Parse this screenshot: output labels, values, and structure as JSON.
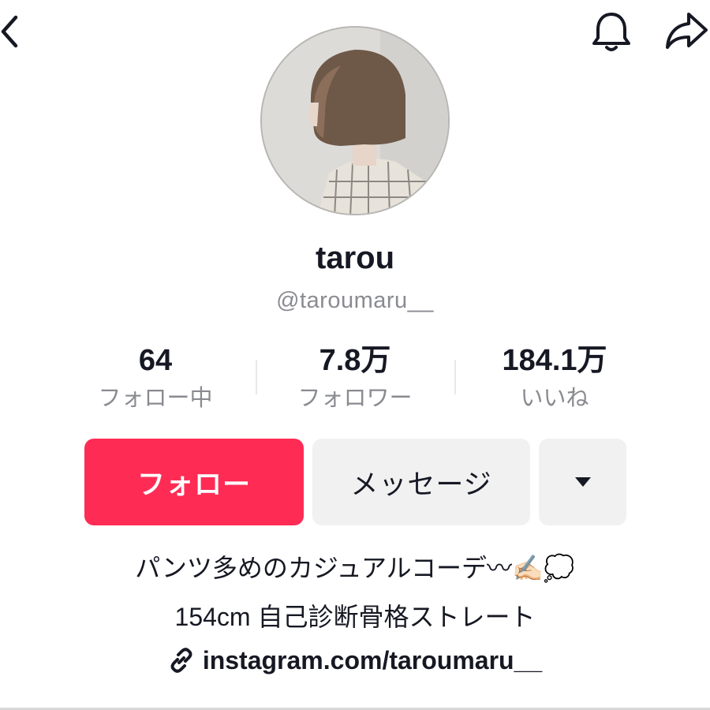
{
  "header": {
    "back_icon": "chevron-left-icon",
    "bell_icon": "bell-icon",
    "share_icon": "share-arrow-icon"
  },
  "profile": {
    "username": "tarou",
    "handle": "@taroumaru__",
    "avatar": "profile-photo"
  },
  "stats": [
    {
      "value": "64",
      "label": "フォロー中"
    },
    {
      "value": "7.8万",
      "label": "フォロワー"
    },
    {
      "value": "184.1万",
      "label": "いいね"
    }
  ],
  "actions": {
    "follow_label": "フォロー",
    "message_label": "メッセージ",
    "more_icon": "caret-down-icon"
  },
  "bio": {
    "line1": "パンツ多めのカジュアルコーデ〰✍🏻💭",
    "line2": "154cm 自己診断骨格ストレート",
    "link": "instagram.com/taroumaru__",
    "link_icon": "link-icon"
  },
  "colors": {
    "follow": "#fe2c55",
    "secondary_bg": "#f1f1f2",
    "muted_text": "#8a8b91",
    "text": "#161823"
  }
}
